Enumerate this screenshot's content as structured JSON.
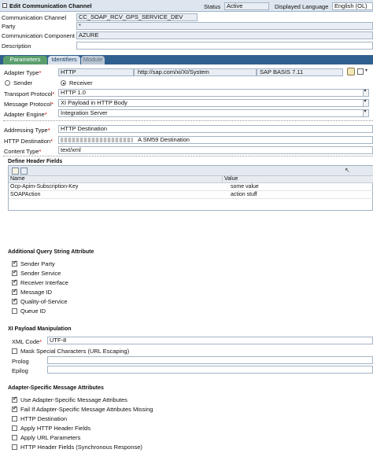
{
  "window": {
    "title": "Edit Communication Channel"
  },
  "header": {
    "status_label": "Status",
    "status_value": "Active",
    "language_label": "Displayed Language",
    "language_value": "English (OL)",
    "channel_label": "Communication Channel",
    "channel_value": "CC_SOAP_RCV_GPS_SERVICE_DEV",
    "party_label": "Party",
    "party_value": "*",
    "component_label": "Communication Component",
    "component_value": "AZURE",
    "description_label": "Description",
    "description_value": ""
  },
  "tabs": [
    {
      "label": "Parameters",
      "state": "active"
    },
    {
      "label": "Identifiers",
      "state": "idle"
    },
    {
      "label": "Module",
      "state": "disabled"
    }
  ],
  "adapter": {
    "type_label": "Adapter Type",
    "type_value": "HTTP",
    "namespace_value": "http://sap.com/xi/XI/System",
    "version_value": "SAP BASIS 7.11",
    "sender_label": "Sender",
    "receiver_label": "Receiver",
    "direction": "receiver",
    "transport_label": "Transport Protocol",
    "transport_value": "HTTP 1.0",
    "message_label": "Message Protocol",
    "message_value": "XI Payload in HTTP Body",
    "engine_label": "Adapter Engine",
    "engine_value": "Integration Server"
  },
  "addressing": {
    "type_label": "Addressing Type",
    "type_value": "HTTP Destination",
    "dest_label": "HTTP Destination",
    "dest_value": "A SM59 Destination",
    "content_label": "Content Type",
    "content_value": "text/xml"
  },
  "header_fields": {
    "section_title": "Define Header Fields",
    "columns": [
      "Name",
      "Value"
    ],
    "rows": [
      {
        "name": "Ocp-Apim-Subscription-Key",
        "value": "some value"
      },
      {
        "name": "SOAPAction",
        "value": "action stuff"
      }
    ]
  },
  "query_string": {
    "section_title": "Additional Query String Attribute",
    "items": [
      {
        "label": "Sender Party",
        "checked": true
      },
      {
        "label": "Sender Service",
        "checked": true
      },
      {
        "label": "Receiver Interface",
        "checked": true
      },
      {
        "label": "Message ID",
        "checked": true
      },
      {
        "label": "Quality-of-Service",
        "checked": true
      },
      {
        "label": "Queue ID",
        "checked": false
      }
    ]
  },
  "payload": {
    "section_title": "XI Payload Manipulation",
    "xml_code_label": "XML Code",
    "xml_code_value": "UTF-8",
    "mask_label": "Mask Special Characters (URL Escaping)",
    "mask_checked": false,
    "prolog_label": "Prolog",
    "prolog_value": "",
    "epilog_label": "Epilog",
    "epilog_value": ""
  },
  "asma": {
    "section_title": "Adapter-Specific Message Attributes",
    "items": [
      {
        "label": "Use Adapter-Specific Message Attributes",
        "checked": true
      },
      {
        "label": "Fail If Adapter-Specific Message Attributes Missing",
        "checked": true
      },
      {
        "label": "HTTP Destination",
        "checked": false
      },
      {
        "label": "Apply HTTP Header Fields",
        "checked": false
      },
      {
        "label": "Apply URL Parameters",
        "checked": false
      },
      {
        "label": "HTTP Header Fields (Synchronous Response)",
        "checked": false
      }
    ]
  }
}
